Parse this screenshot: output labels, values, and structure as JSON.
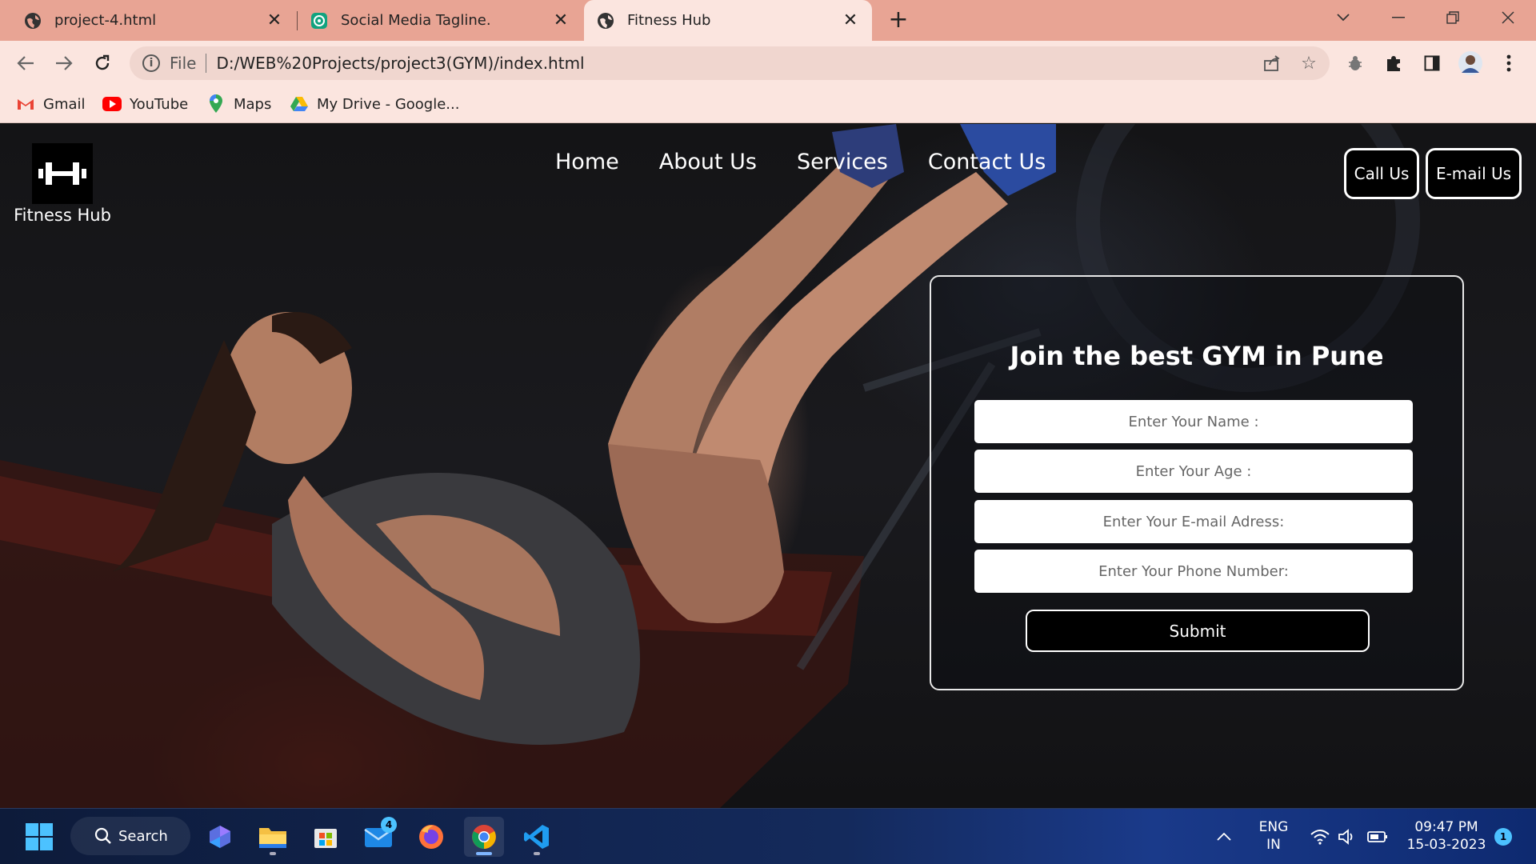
{
  "browser": {
    "tabs": [
      {
        "title": "project-4.html",
        "active": false
      },
      {
        "title": "Social Media Tagline.",
        "active": false
      },
      {
        "title": "Fitness Hub",
        "active": true
      }
    ],
    "address": {
      "scheme": "File",
      "url": "D:/WEB%20Projects/project3(GYM)/index.html"
    },
    "bookmarks": [
      "Gmail",
      "YouTube",
      "Maps",
      "My Drive - Google..."
    ]
  },
  "site": {
    "brand": "Fitness Hub",
    "nav": [
      "Home",
      "About Us",
      "Services",
      "Contact Us"
    ],
    "cta": {
      "call": "Call Us",
      "email": "E-mail Us"
    },
    "form": {
      "title": "Join the best GYM in Pune",
      "name_placeholder": "Enter Your Name :",
      "age_placeholder": "Enter Your Age :",
      "email_placeholder": "Enter Your E-mail Adress:",
      "phone_placeholder": "Enter Your Phone Number:",
      "submit": "Submit"
    }
  },
  "taskbar": {
    "search": "Search",
    "mail_badge": "4",
    "lang_1": "ENG",
    "lang_2": "IN",
    "time": "09:47 PM",
    "date": "15-03-2023",
    "notifications": "1"
  },
  "colors": {
    "tabbar": "#e8a494",
    "toolbar": "#fbe5df",
    "accent": "#ffffff"
  }
}
